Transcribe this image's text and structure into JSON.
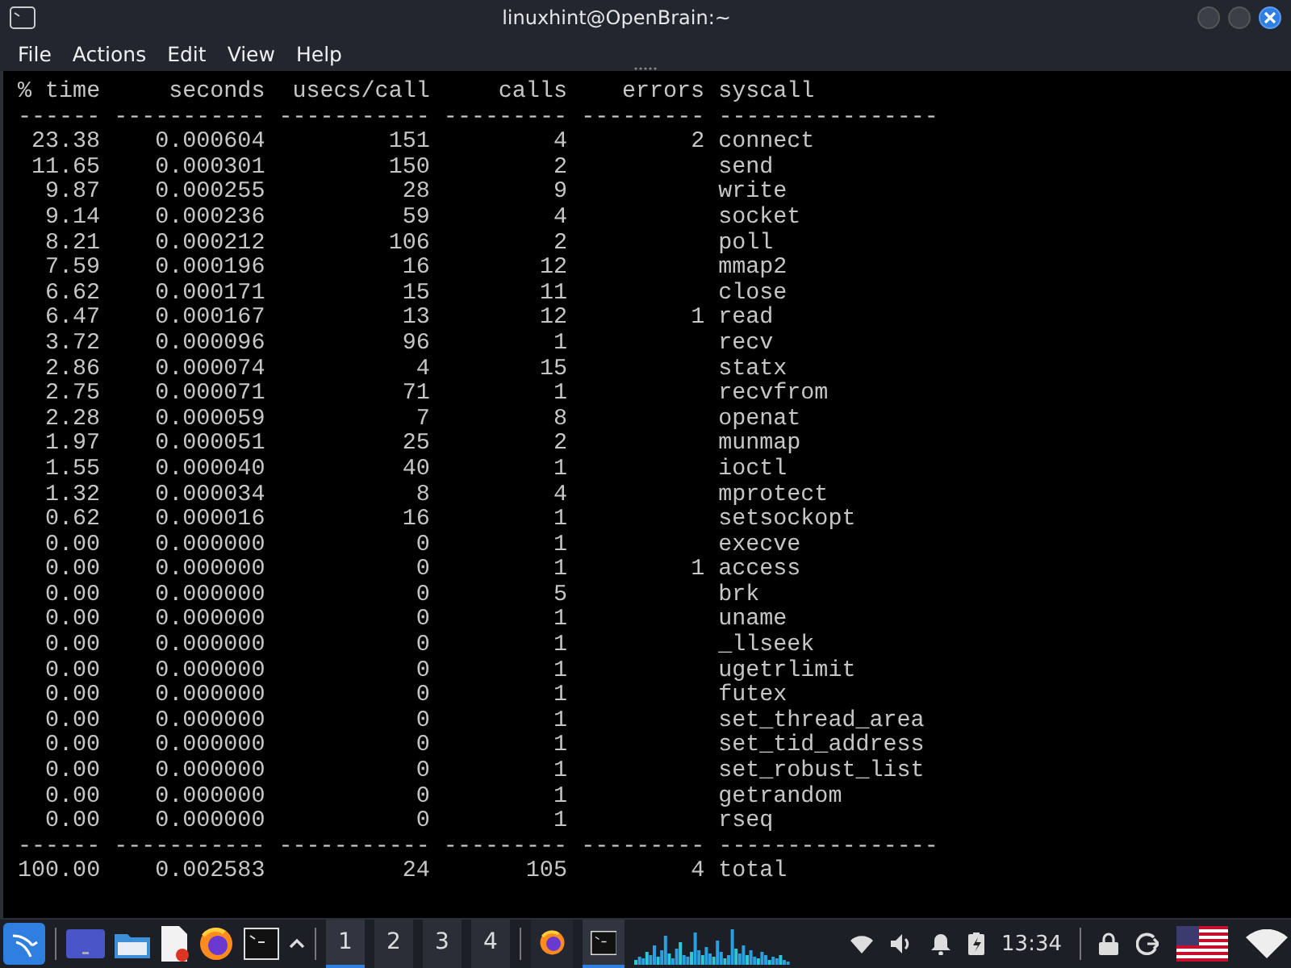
{
  "window": {
    "title": "linuxhint@OpenBrain:~",
    "controls": [
      {
        "kind": "minimize"
      },
      {
        "kind": "maximize"
      },
      {
        "kind": "close"
      }
    ]
  },
  "menu": [
    "File",
    "Actions",
    "Edit",
    "View",
    "Help"
  ],
  "table": {
    "columns": [
      "% time",
      "seconds",
      "usecs/call",
      "calls",
      "errors",
      "syscall"
    ],
    "rule_top": "------ ----------- ----------- --------- --------- ----------------",
    "rows": [
      {
        "time": "23.38",
        "seconds": "0.000604",
        "usecs_call": "151",
        "calls": "4",
        "errors": "2",
        "syscall": "connect"
      },
      {
        "time": "11.65",
        "seconds": "0.000301",
        "usecs_call": "150",
        "calls": "2",
        "syscall": "send"
      },
      {
        "time": "9.87",
        "seconds": "0.000255",
        "usecs_call": "28",
        "calls": "9",
        "syscall": "write"
      },
      {
        "time": "9.14",
        "seconds": "0.000236",
        "usecs_call": "59",
        "calls": "4",
        "syscall": "socket"
      },
      {
        "time": "8.21",
        "seconds": "0.000212",
        "usecs_call": "106",
        "calls": "2",
        "syscall": "poll"
      },
      {
        "time": "7.59",
        "seconds": "0.000196",
        "usecs_call": "16",
        "calls": "12",
        "syscall": "mmap2"
      },
      {
        "time": "6.62",
        "seconds": "0.000171",
        "usecs_call": "15",
        "calls": "11",
        "syscall": "close"
      },
      {
        "time": "6.47",
        "seconds": "0.000167",
        "usecs_call": "13",
        "calls": "12",
        "errors": "1",
        "syscall": "read"
      },
      {
        "time": "3.72",
        "seconds": "0.000096",
        "usecs_call": "96",
        "calls": "1",
        "syscall": "recv"
      },
      {
        "time": "2.86",
        "seconds": "0.000074",
        "usecs_call": "4",
        "calls": "15",
        "syscall": "statx"
      },
      {
        "time": "2.75",
        "seconds": "0.000071",
        "usecs_call": "71",
        "calls": "1",
        "syscall": "recvfrom"
      },
      {
        "time": "2.28",
        "seconds": "0.000059",
        "usecs_call": "7",
        "calls": "8",
        "syscall": "openat"
      },
      {
        "time": "1.97",
        "seconds": "0.000051",
        "usecs_call": "25",
        "calls": "2",
        "syscall": "munmap"
      },
      {
        "time": "1.55",
        "seconds": "0.000040",
        "usecs_call": "40",
        "calls": "1",
        "syscall": "ioctl"
      },
      {
        "time": "1.32",
        "seconds": "0.000034",
        "usecs_call": "8",
        "calls": "4",
        "syscall": "mprotect"
      },
      {
        "time": "0.62",
        "seconds": "0.000016",
        "usecs_call": "16",
        "calls": "1",
        "syscall": "setsockopt"
      },
      {
        "time": "0.00",
        "seconds": "0.000000",
        "usecs_call": "0",
        "calls": "1",
        "syscall": "execve"
      },
      {
        "time": "0.00",
        "seconds": "0.000000",
        "usecs_call": "0",
        "calls": "1",
        "errors": "1",
        "syscall": "access"
      },
      {
        "time": "0.00",
        "seconds": "0.000000",
        "usecs_call": "0",
        "calls": "5",
        "syscall": "brk"
      },
      {
        "time": "0.00",
        "seconds": "0.000000",
        "usecs_call": "0",
        "calls": "1",
        "syscall": "uname"
      },
      {
        "time": "0.00",
        "seconds": "0.000000",
        "usecs_call": "0",
        "calls": "1",
        "syscall": "_llseek"
      },
      {
        "time": "0.00",
        "seconds": "0.000000",
        "usecs_call": "0",
        "calls": "1",
        "syscall": "ugetrlimit"
      },
      {
        "time": "0.00",
        "seconds": "0.000000",
        "usecs_call": "0",
        "calls": "1",
        "syscall": "futex"
      },
      {
        "time": "0.00",
        "seconds": "0.000000",
        "usecs_call": "0",
        "calls": "1",
        "syscall": "set_thread_area"
      },
      {
        "time": "0.00",
        "seconds": "0.000000",
        "usecs_call": "0",
        "calls": "1",
        "syscall": "set_tid_address"
      },
      {
        "time": "0.00",
        "seconds": "0.000000",
        "usecs_call": "0",
        "calls": "1",
        "syscall": "set_robust_list"
      },
      {
        "time": "0.00",
        "seconds": "0.000000",
        "usecs_call": "0",
        "calls": "1",
        "syscall": "getrandom"
      },
      {
        "time": "0.00",
        "seconds": "0.000000",
        "usecs_call": "0",
        "calls": "1",
        "syscall": "rseq"
      }
    ],
    "rule_bottom": "------ ----------- ----------- --------- --------- ----------------",
    "total": {
      "time": "100.00",
      "seconds": "0.002583",
      "usecs_call": "24",
      "calls": "105",
      "errors": "4",
      "syscall": "total"
    }
  },
  "taskbar": {
    "launchers": [
      {
        "kind": "menu"
      },
      {
        "kind": "desktop"
      },
      {
        "kind": "files"
      },
      {
        "kind": "editor"
      },
      {
        "kind": "browser"
      },
      {
        "kind": "terminal"
      },
      {
        "kind": "caret"
      }
    ],
    "workspaces": [
      {
        "label": "1",
        "selected": true
      },
      {
        "label": "2",
        "selected": false
      },
      {
        "label": "3",
        "selected": false
      },
      {
        "label": "4",
        "selected": false
      }
    ],
    "tasks": [
      {
        "kind": "browser",
        "selected": false
      },
      {
        "kind": "terminal",
        "selected": true
      }
    ],
    "tray": [
      {
        "kind": "wifi"
      },
      {
        "kind": "volume"
      },
      {
        "kind": "bell"
      },
      {
        "kind": "battery"
      }
    ],
    "clock": "13:34",
    "tray_right": [
      {
        "kind": "lock"
      },
      {
        "kind": "logout"
      },
      {
        "kind": "flag"
      },
      {
        "kind": "network"
      }
    ]
  }
}
